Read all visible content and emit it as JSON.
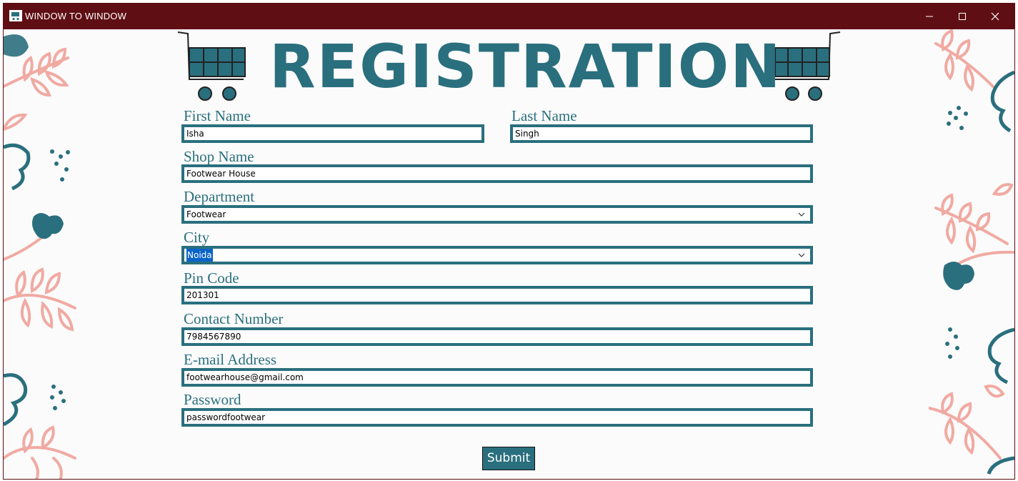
{
  "window": {
    "title": "WINDOW TO WINDOW"
  },
  "header": {
    "title": "REGISTRATION"
  },
  "form": {
    "first_name": {
      "label": "First Name",
      "value": "Isha"
    },
    "last_name": {
      "label": "Last Name",
      "value": "Singh"
    },
    "shop_name": {
      "label": "Shop Name",
      "value": "Footwear House"
    },
    "department": {
      "label": "Department",
      "value": "Footwear"
    },
    "city": {
      "label": "City",
      "value": "Noida"
    },
    "pin_code": {
      "label": "Pin Code",
      "value": "201301"
    },
    "contact_number": {
      "label": "Contact Number",
      "value": "7984567890"
    },
    "email": {
      "label": "E-mail Address",
      "value": "footwearhouse@gmail.com"
    },
    "password": {
      "label": "Password",
      "value": "passwordfootwear"
    },
    "submit_label": "Submit"
  },
  "colors": {
    "titlebar": "#5f0f14",
    "accent": "#2a6f7e",
    "leaf_pink": "#f0aaa2"
  },
  "icons": [
    "shopping-cart-icon",
    "minimize-icon",
    "maximize-icon",
    "close-icon",
    "chevron-down-icon"
  ]
}
